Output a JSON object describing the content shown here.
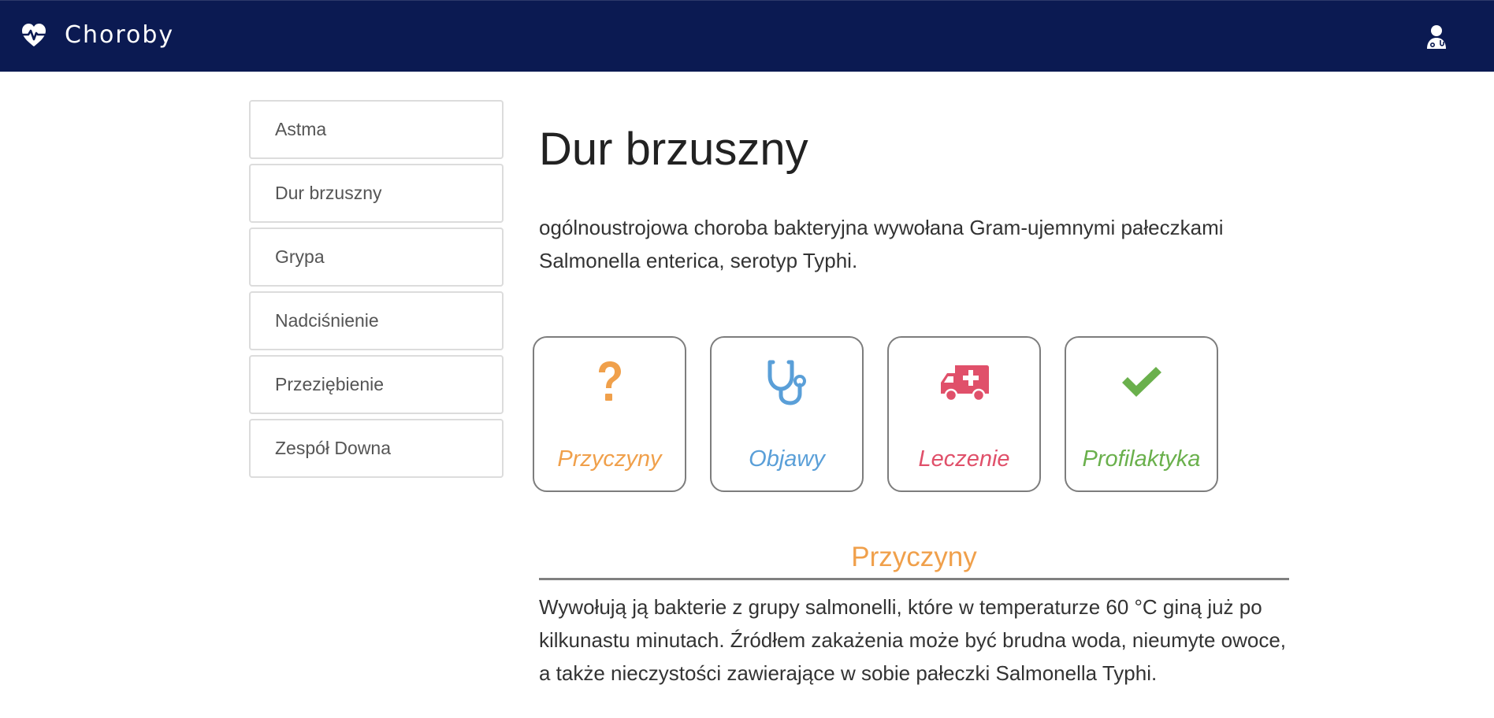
{
  "navbar": {
    "brand_icon": "heartbeat-icon",
    "brand_text": "Choroby",
    "user_icon": "user-doctor-icon",
    "background": "#0b1a52"
  },
  "sidebar": {
    "items": [
      {
        "label": "Astma"
      },
      {
        "label": "Dur brzuszny"
      },
      {
        "label": "Grypa"
      },
      {
        "label": "Nadciśnienie"
      },
      {
        "label": "Przeziębienie"
      },
      {
        "label": "Zespół Downa"
      }
    ]
  },
  "main": {
    "title": "Dur brzuszny",
    "description": "ogólnoustrojowa choroba bakteryjna wywołana Gram-ujemnymi pałeczkami Salmonella enterica, serotyp Typhi.",
    "cards": [
      {
        "label": "Przyczyny",
        "icon": "question-icon",
        "color": "#f0a04b"
      },
      {
        "label": "Objawy",
        "icon": "stethoscope-icon",
        "color": "#5a9fd8"
      },
      {
        "label": "Leczenie",
        "icon": "ambulance-icon",
        "color": "#e0506a"
      },
      {
        "label": "Profilaktyka",
        "icon": "check-icon",
        "color": "#6ab04c"
      }
    ],
    "section": {
      "title": "Przyczyny",
      "color": "#f0a04b",
      "body": "Wywołują ją bakterie z grupy salmonelli, które w temperaturze 60 °C giną już po kilkunastu minutach. Źródłem zakażenia może być brudna woda, nieumyte owoce, a także nieczystości zawierające w sobie pałeczki Salmonella Typhi."
    }
  }
}
